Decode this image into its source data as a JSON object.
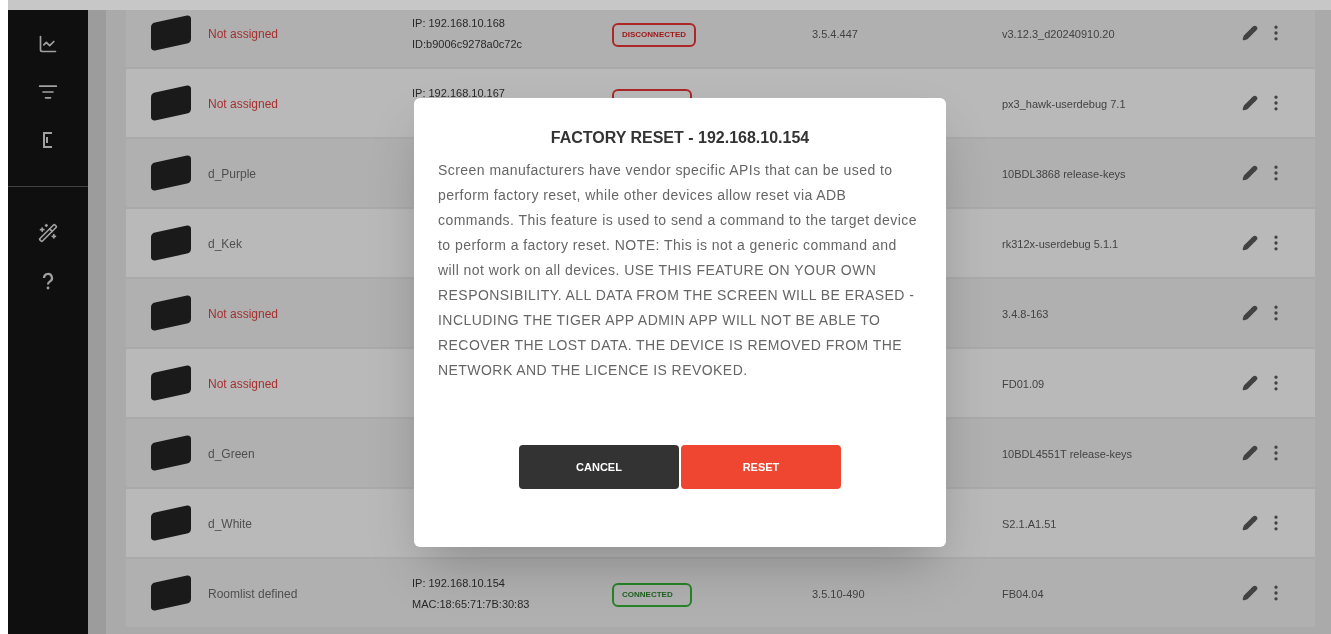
{
  "sidebar": {
    "items": [
      {
        "kind": "chart"
      },
      {
        "kind": "list"
      },
      {
        "kind": "bracket"
      },
      {
        "kind": "divider"
      },
      {
        "kind": "wand"
      },
      {
        "kind": "help"
      }
    ]
  },
  "devices": [
    {
      "name": "Not assigned",
      "assigned": false,
      "ip": "IP: 192.168.10.168",
      "id": "ID:b9006c9278a0c72c",
      "status": {
        "label": "DISCONNECTED",
        "kind": "disconnected"
      },
      "version": "3.5.4.447",
      "build": "v3.12.3_d20240910.20"
    },
    {
      "name": "Not assigned",
      "assigned": false,
      "ip": "IP: 192.168.10.167",
      "status": {
        "kind": "disconnected"
      },
      "build": "px3_hawk-userdebug 7.1"
    },
    {
      "name": "d_Purple",
      "assigned": true,
      "build": "10BDL3868 release-keys"
    },
    {
      "name": "d_Kek",
      "assigned": true,
      "build": "rk312x-userdebug 5.1.1"
    },
    {
      "name": "Not assigned",
      "assigned": false,
      "build": "3.4.8-163"
    },
    {
      "name": "Not assigned",
      "assigned": false,
      "build": "FD01.09"
    },
    {
      "name": "d_Green",
      "assigned": true,
      "build": "10BDL4551T release-keys"
    },
    {
      "name": "d_White",
      "assigned": true,
      "build": "S2.1.A1.51"
    },
    {
      "name": "Roomlist defined",
      "assigned": true,
      "ip": "IP: 192.168.10.154",
      "id": "MAC:18:65:71:7B:30:83",
      "status": {
        "label": "CONNECTED",
        "kind": "connected"
      },
      "version": "3.5.10-490",
      "build": "FB04.04"
    }
  ],
  "dialog": {
    "title": "FACTORY RESET - 192.168.10.154",
    "body": "Screen manufacturers have vendor specific APIs that can be used to perform factory reset, while other devices allow reset via ADB commands. This feature is used to send a command to the target device to perform a factory reset. NOTE: This is not a generic command and will not work on all devices. USE THIS FEATURE ON YOUR OWN RESPONSIBILITY. ALL DATA FROM THE SCREEN WILL BE ERASED - INCLUDING THE TIGER APP ADMIN APP WILL NOT BE ABLE TO RECOVER THE LOST DATA. THE DEVICE IS REMOVED FROM THE NETWORK AND THE LICENCE IS REVOKED.",
    "buttons": [
      {
        "label": "CANCEL",
        "kind": "secondary"
      },
      {
        "label": "RESET",
        "kind": "danger"
      }
    ]
  }
}
